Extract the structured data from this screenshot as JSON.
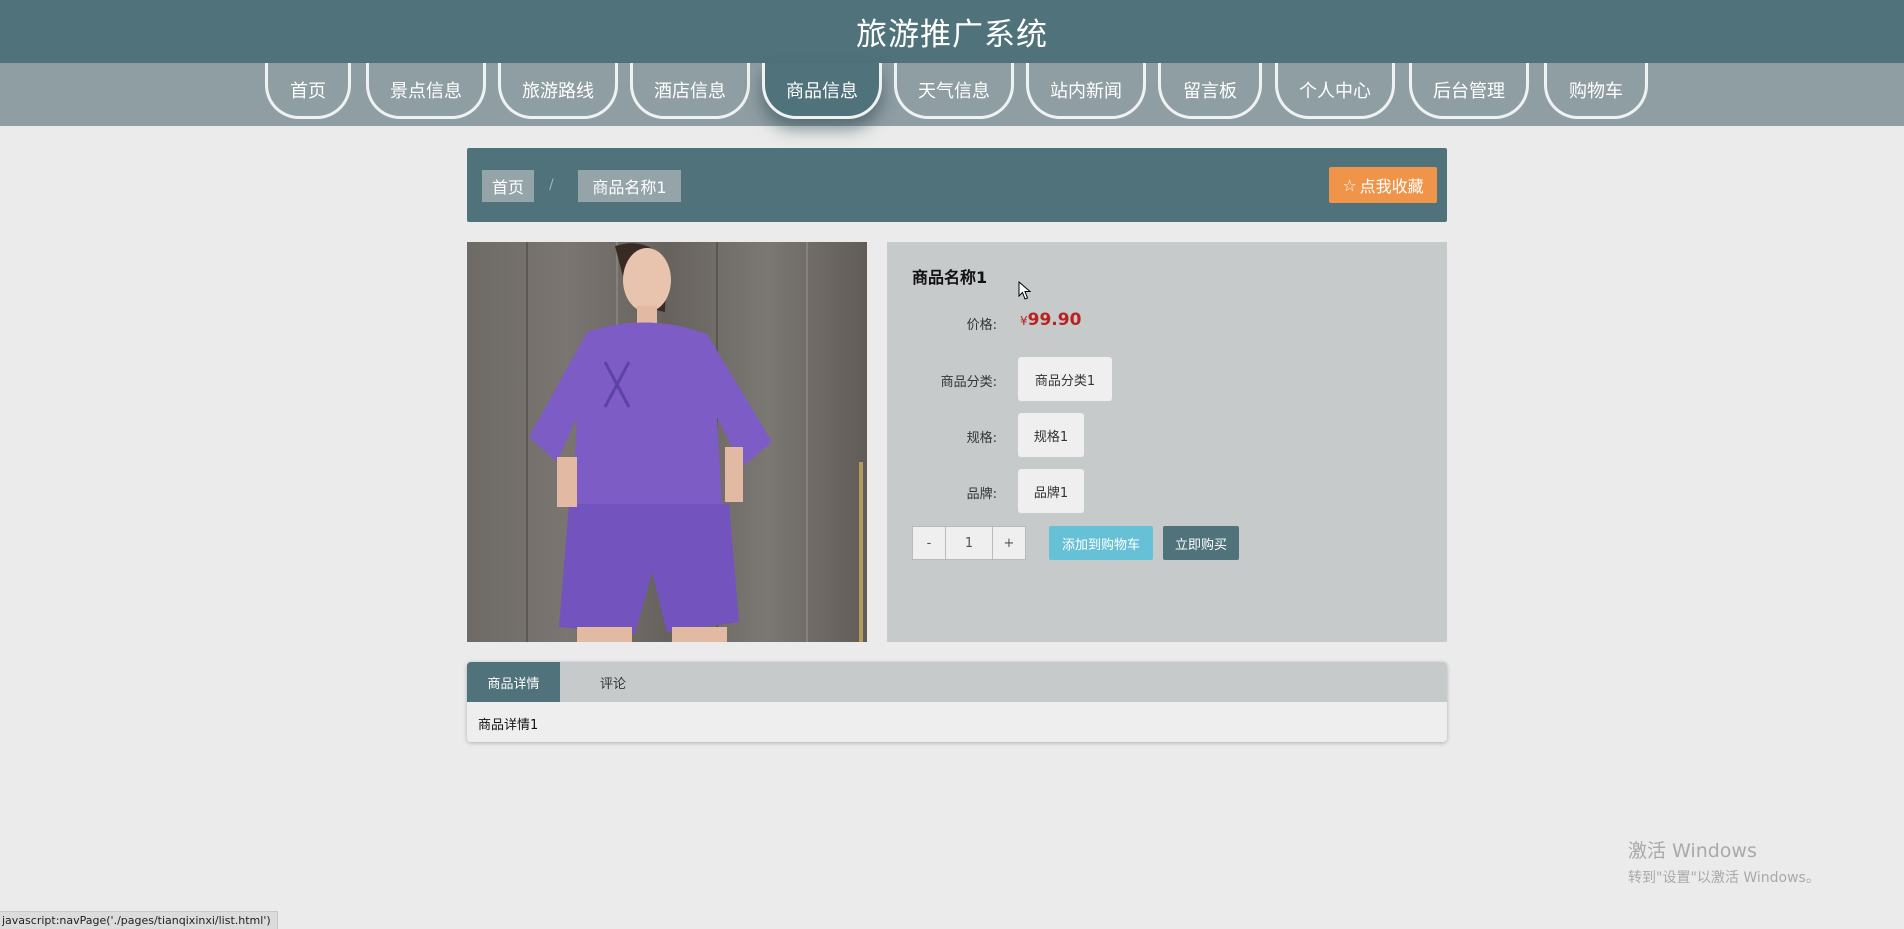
{
  "header": {
    "title": "旅游推广系统"
  },
  "nav": {
    "items": [
      {
        "label": "首页"
      },
      {
        "label": "景点信息"
      },
      {
        "label": "旅游路线"
      },
      {
        "label": "酒店信息"
      },
      {
        "label": "商品信息",
        "active": true
      },
      {
        "label": "天气信息"
      },
      {
        "label": "站内新闻"
      },
      {
        "label": "留言板"
      },
      {
        "label": "个人中心"
      },
      {
        "label": "后台管理"
      },
      {
        "label": "购物车"
      }
    ]
  },
  "breadcrumb": {
    "home": "首页",
    "separator": "/",
    "current": "商品名称1"
  },
  "favorite_button": {
    "icon": "star-outline-icon",
    "label": "点我收藏"
  },
  "product": {
    "image_alt": "woman in purple t-shirt and shorts",
    "name": "商品名称1",
    "price_label": "价格:",
    "currency": "¥",
    "price": "99.90",
    "category_label": "商品分类:",
    "category": "商品分类1",
    "spec_label": "规格:",
    "spec": "规格1",
    "brand_label": "品牌:",
    "brand": "品牌1"
  },
  "purchase": {
    "minus": "-",
    "quantity": "1",
    "plus": "+",
    "add_to_cart": "添加到购物车",
    "buy_now": "立即购买"
  },
  "tabs": {
    "items": [
      {
        "label": "商品详情",
        "active": true
      },
      {
        "label": "评论"
      }
    ],
    "content": "商品详情1"
  },
  "watermark": {
    "line1": "激活 Windows",
    "line2": "转到\"设置\"以激活 Windows。"
  },
  "status_bar": {
    "url": "javascript:navPage('./pages/tianqixinxi/list.html')"
  },
  "colors": {
    "primary": "#4f727b",
    "nav_bg": "#8f9ea3",
    "favorite": "#f0944a",
    "cart": "#66c1d6",
    "price": "#b8231f",
    "page_bg": "#ebebeb"
  }
}
